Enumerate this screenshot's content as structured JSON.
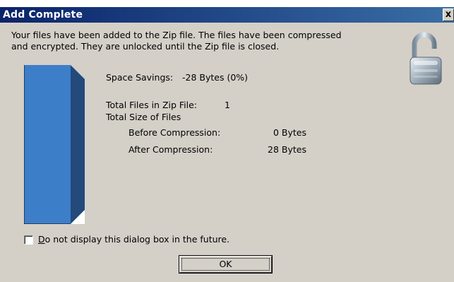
{
  "window": {
    "title": "Add Complete",
    "close_label": "x"
  },
  "message": {
    "line1": "Your files have been added to the Zip file. The files have been compressed",
    "line2": "and encrypted. They are unlocked until the Zip file is closed."
  },
  "stats": {
    "space_savings_label": "Space Savings:",
    "space_savings_value": "-28 Bytes (0%)",
    "total_files_label": "Total Files in Zip File:",
    "total_files_value": "1",
    "total_size_label": "Total Size of Files",
    "before_label": "Before Compression:",
    "before_value": "0 Bytes",
    "after_label": "After Compression:",
    "after_value": "28 Bytes"
  },
  "savings_bar": {
    "fill_fraction": 1.0,
    "fill_color": "#3d7ec9",
    "top_color": "#fce8a0",
    "side_color": "#234a7a"
  },
  "checkbox": {
    "checked": false,
    "label": "Do not display this dialog box in the future.",
    "accel": "D"
  },
  "buttons": {
    "ok_label": "OK"
  },
  "icons": {
    "lock": "unlocked-padlock-icon"
  }
}
